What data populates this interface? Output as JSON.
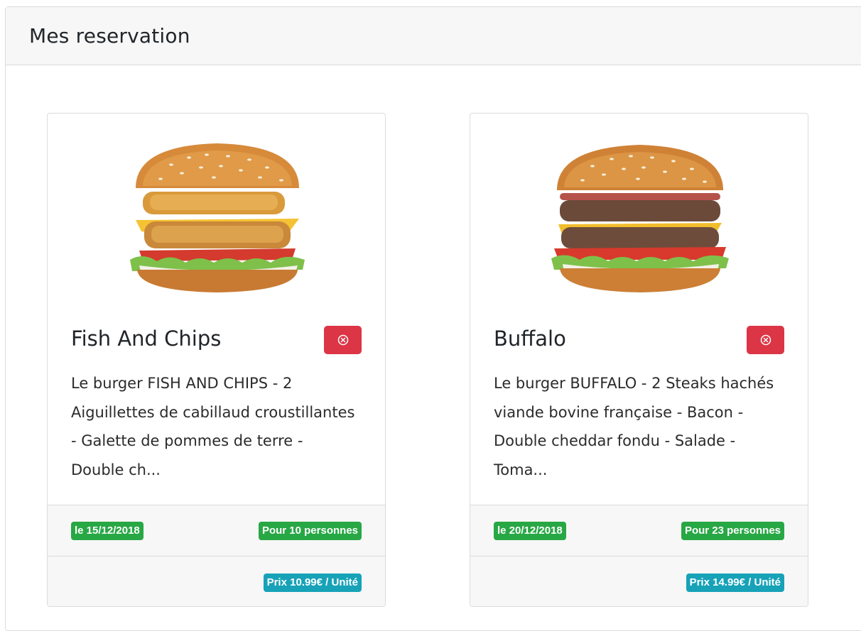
{
  "header": {
    "title": "Mes reservation"
  },
  "colors": {
    "danger": "#dc3545",
    "success": "#28a745",
    "info": "#17a2b8"
  },
  "reservations": [
    {
      "title": "Fish And Chips",
      "description": "Le burger FISH AND CHIPS - 2 Aiguillettes de cabillaud croustillantes - Galette de pommes de terre - Double ch...",
      "date": "le 15/12/2018",
      "persons": "Pour 10 personnes",
      "price": "Prix 10.99€ / Unité",
      "image_icon": "fish-burger-image",
      "delete_icon": "close-circle-icon"
    },
    {
      "title": "Buffalo",
      "description": "Le burger BUFFALO - 2 Steaks hachés viande bovine française - Bacon - Double cheddar fondu - Salade - Toma...",
      "date": "le 20/12/2018",
      "persons": "Pour 23 personnes",
      "price": "Prix 14.99€ / Unité",
      "image_icon": "beef-burger-image",
      "delete_icon": "close-circle-icon"
    }
  ]
}
